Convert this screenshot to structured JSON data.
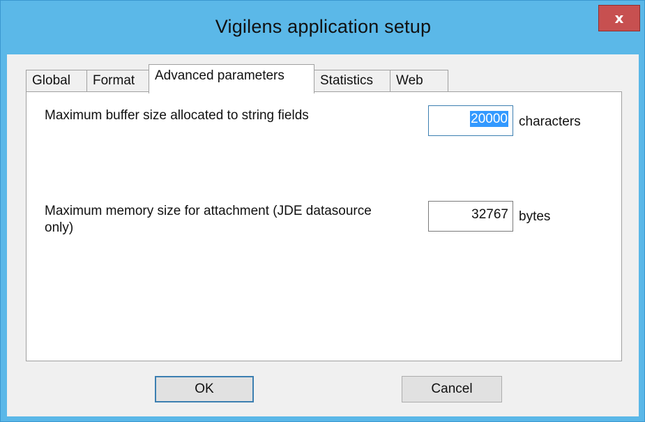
{
  "window": {
    "title": "Vigilens application setup",
    "close_label": "x"
  },
  "tabs": [
    {
      "label": "Global",
      "active": false
    },
    {
      "label": "Format",
      "active": false
    },
    {
      "label": "Advanced parameters",
      "active": true
    },
    {
      "label": "Statistics",
      "active": false
    },
    {
      "label": "Web",
      "active": false
    }
  ],
  "advanced": {
    "buffer": {
      "label": "Maximum buffer size allocated to string fields",
      "value": "20000",
      "unit": "characters"
    },
    "memory": {
      "label_line1": "Maximum memory size for attachment (JDE datasource",
      "label_line2": "only)",
      "value": "32767",
      "unit": "bytes"
    }
  },
  "buttons": {
    "ok": "OK",
    "cancel": "Cancel"
  },
  "colors": {
    "frame": "#5bb8e8",
    "close": "#c75050",
    "selection": "#3399ff",
    "focus": "#3c7fb1"
  }
}
